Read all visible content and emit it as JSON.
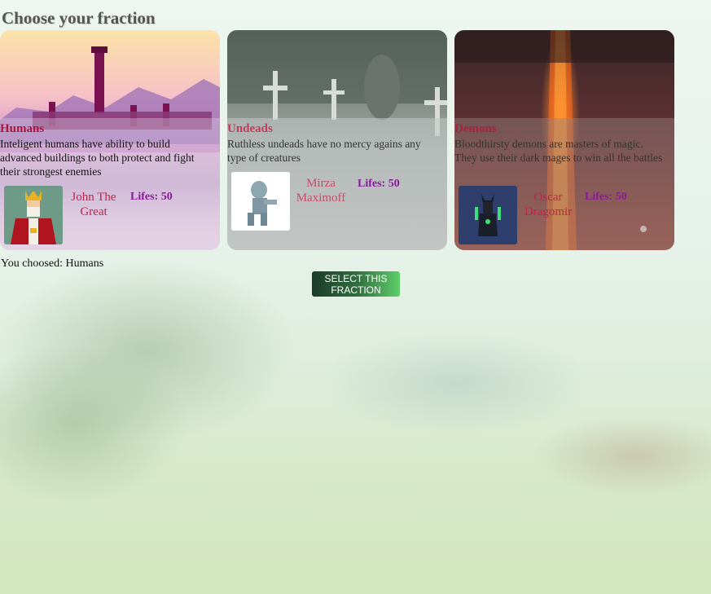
{
  "page": {
    "title": "Choose your fraction"
  },
  "fractions": [
    {
      "name": "Humans",
      "description": "Inteligent humans have ability to build advanced buildings to both protect and fight their strongest enemies",
      "hero": "John The Great",
      "lifes": "Lifes: 50",
      "avatar_icon": "king-icon"
    },
    {
      "name": "Undeads",
      "description": "Ruthless undeads have no mercy agains any type of creatures",
      "hero": "Mirza Maximoff",
      "lifes": "Lifes: 50",
      "avatar_icon": "zombie-icon"
    },
    {
      "name": "Demons",
      "description": "Bloodthirsty demons are masters of magic. They use their dark mages to win all the battles",
      "hero": "Oscar Dragomir",
      "lifes": "Lifes: 50",
      "avatar_icon": "demon-mage-icon"
    }
  ],
  "status": {
    "chosen": "You choosed: Humans"
  },
  "actions": {
    "select_label": "Select this fraction"
  },
  "colors": {
    "fraction_name": "#b0143a",
    "hero_name": "#c0224a",
    "lifes": "#8b1a9a",
    "button_start": "#1d3b2a",
    "button_end": "#5fcf6b"
  }
}
